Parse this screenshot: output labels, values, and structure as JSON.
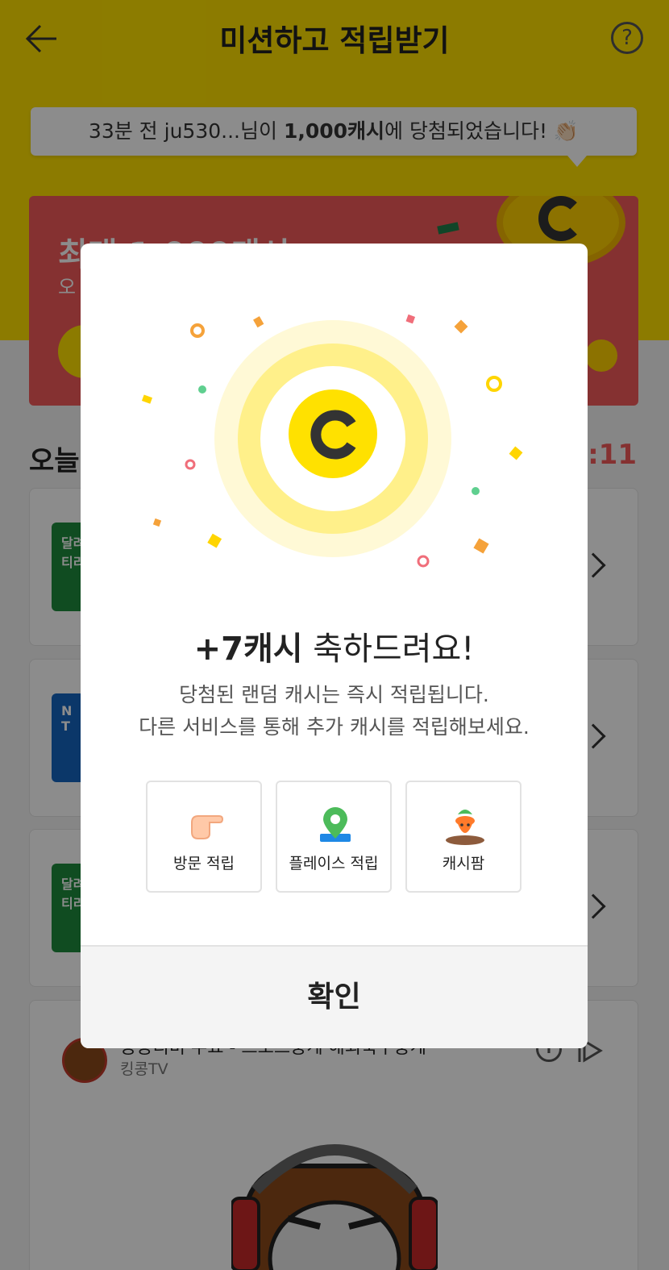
{
  "header": {
    "title": "미션하고 적립받기",
    "back_icon": "arrow-left-icon",
    "help_glyph": "?"
  },
  "ticker": {
    "prefix": "33분 전 ju530...님이 ",
    "highlight": "1,000캐시",
    "suffix": "에 당첨되었습니다! 👏🏻"
  },
  "banner": {
    "title": "최대 1,000캐시",
    "subtitle": "오"
  },
  "today": {
    "label": "오늘",
    "timer": "0:11"
  },
  "missions": [
    {
      "thumb_text": "달려\n티리",
      "thumb_color": "#1e8a3c"
    },
    {
      "thumb_text": "N\nT",
      "thumb_color": "#1565c0"
    },
    {
      "thumb_text": "달려\n티리",
      "thumb_color": "#1e8a3c"
    }
  ],
  "video": {
    "title": "콩콩티비 주요 - 스포츠중계 해외축구중계",
    "channel": "킹콩TV"
  },
  "modal": {
    "reward_amount": "+7캐시",
    "reward_message": " 축하드려요!",
    "desc_line1": "당첨된 랜덤 캐시는 즉시 적립됩니다.",
    "desc_line2": "다른 서비스를 통해 추가 캐시를 적립해보세요.",
    "coin_letter": "C",
    "services": [
      {
        "label": "방문 적립",
        "icon": "pointing-hand-icon"
      },
      {
        "label": "플레이스 적립",
        "icon": "map-pin-icon"
      },
      {
        "label": "캐시팜",
        "icon": "carrot-icon"
      }
    ],
    "confirm_label": "확인"
  },
  "colors": {
    "brand_yellow": "#ffe100",
    "banner_red": "#f25a5a",
    "text_dark": "#222222"
  }
}
